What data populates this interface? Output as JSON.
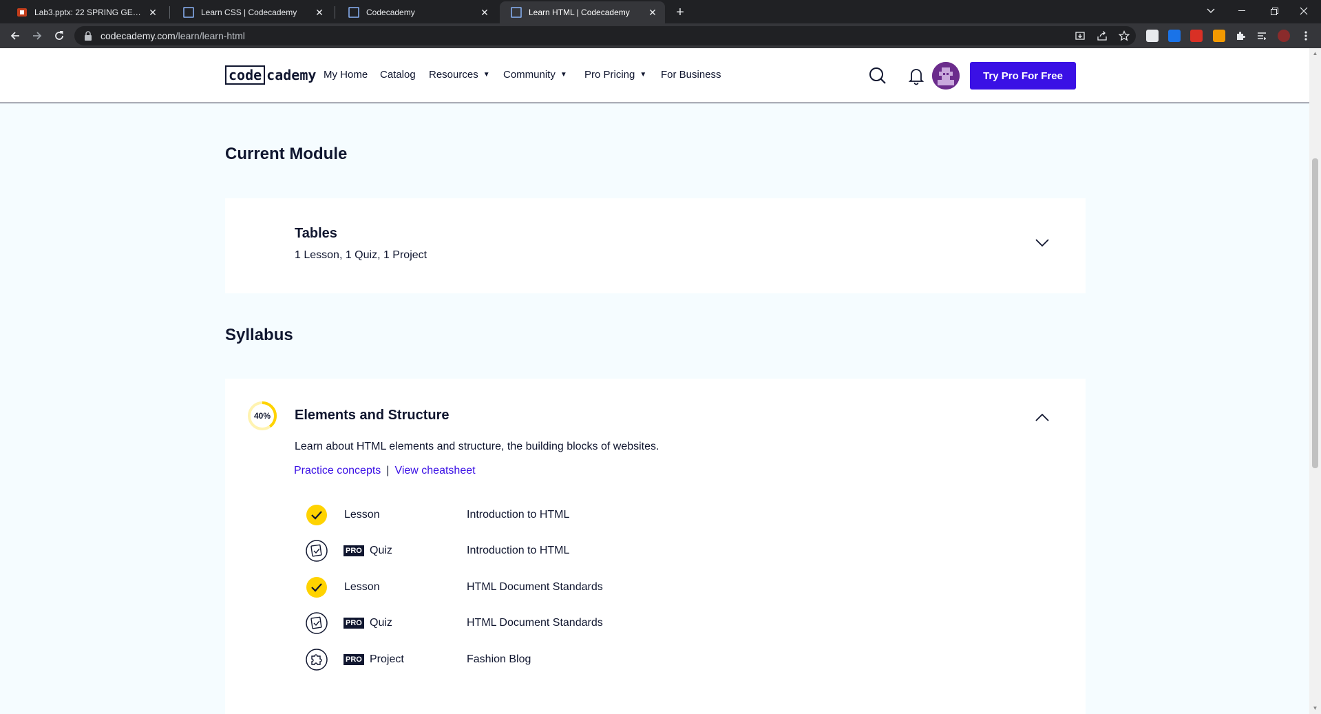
{
  "browser": {
    "tabs": [
      {
        "title": "Lab3.pptx: 22 SPRING GEOG 478...",
        "active": false
      },
      {
        "title": "Learn CSS | Codecademy",
        "active": false
      },
      {
        "title": "Codecademy",
        "active": false
      },
      {
        "title": "Learn HTML | Codecademy",
        "active": true
      }
    ],
    "close_glyph": "✕",
    "new_tab_glyph": "+",
    "url_host": "codecademy.com",
    "url_path": "/learn/learn-html"
  },
  "header": {
    "logo_boxed": "code",
    "logo_rest": "cademy",
    "nav": [
      {
        "label": "My Home",
        "dropdown": false
      },
      {
        "label": "Catalog",
        "dropdown": false
      },
      {
        "label": "Resources",
        "dropdown": true
      },
      {
        "label": "Community",
        "dropdown": true
      },
      {
        "label": "Pro Pricing",
        "dropdown": true
      },
      {
        "label": "For Business",
        "dropdown": false
      }
    ],
    "caret": "▼",
    "cta_label": "Try Pro For Free"
  },
  "current_module": {
    "heading": "Current Module",
    "title": "Tables",
    "subtitle": "1 Lesson, 1 Quiz, 1 Project"
  },
  "syllabus": {
    "heading": "Syllabus",
    "module": {
      "progress_label": "40%",
      "progress": 0.4,
      "title": "Elements and Structure",
      "description": "Learn about HTML elements and structure, the building blocks of websites.",
      "links": {
        "practice": "Practice concepts",
        "separator": "|",
        "cheatsheet": "View cheatsheet"
      },
      "items": [
        {
          "type": "Lesson",
          "name": "Introduction to HTML",
          "pro": false,
          "icon": "completed-check-icon"
        },
        {
          "type": "Quiz",
          "name": "Introduction to HTML",
          "pro": true,
          "icon": "quiz-icon"
        },
        {
          "type": "Lesson",
          "name": "HTML Document Standards",
          "pro": false,
          "icon": "completed-check-icon"
        },
        {
          "type": "Quiz",
          "name": "HTML Document Standards",
          "pro": true,
          "icon": "quiz-icon"
        },
        {
          "type": "Project",
          "name": "Fashion Blog",
          "pro": true,
          "icon": "project-puzzle-icon"
        }
      ],
      "pro_badge": "PRO"
    }
  },
  "colors": {
    "accent": "#3a10e5",
    "navy": "#10162f",
    "page_bg": "#f5fcff",
    "check_yellow": "#ffd300"
  }
}
